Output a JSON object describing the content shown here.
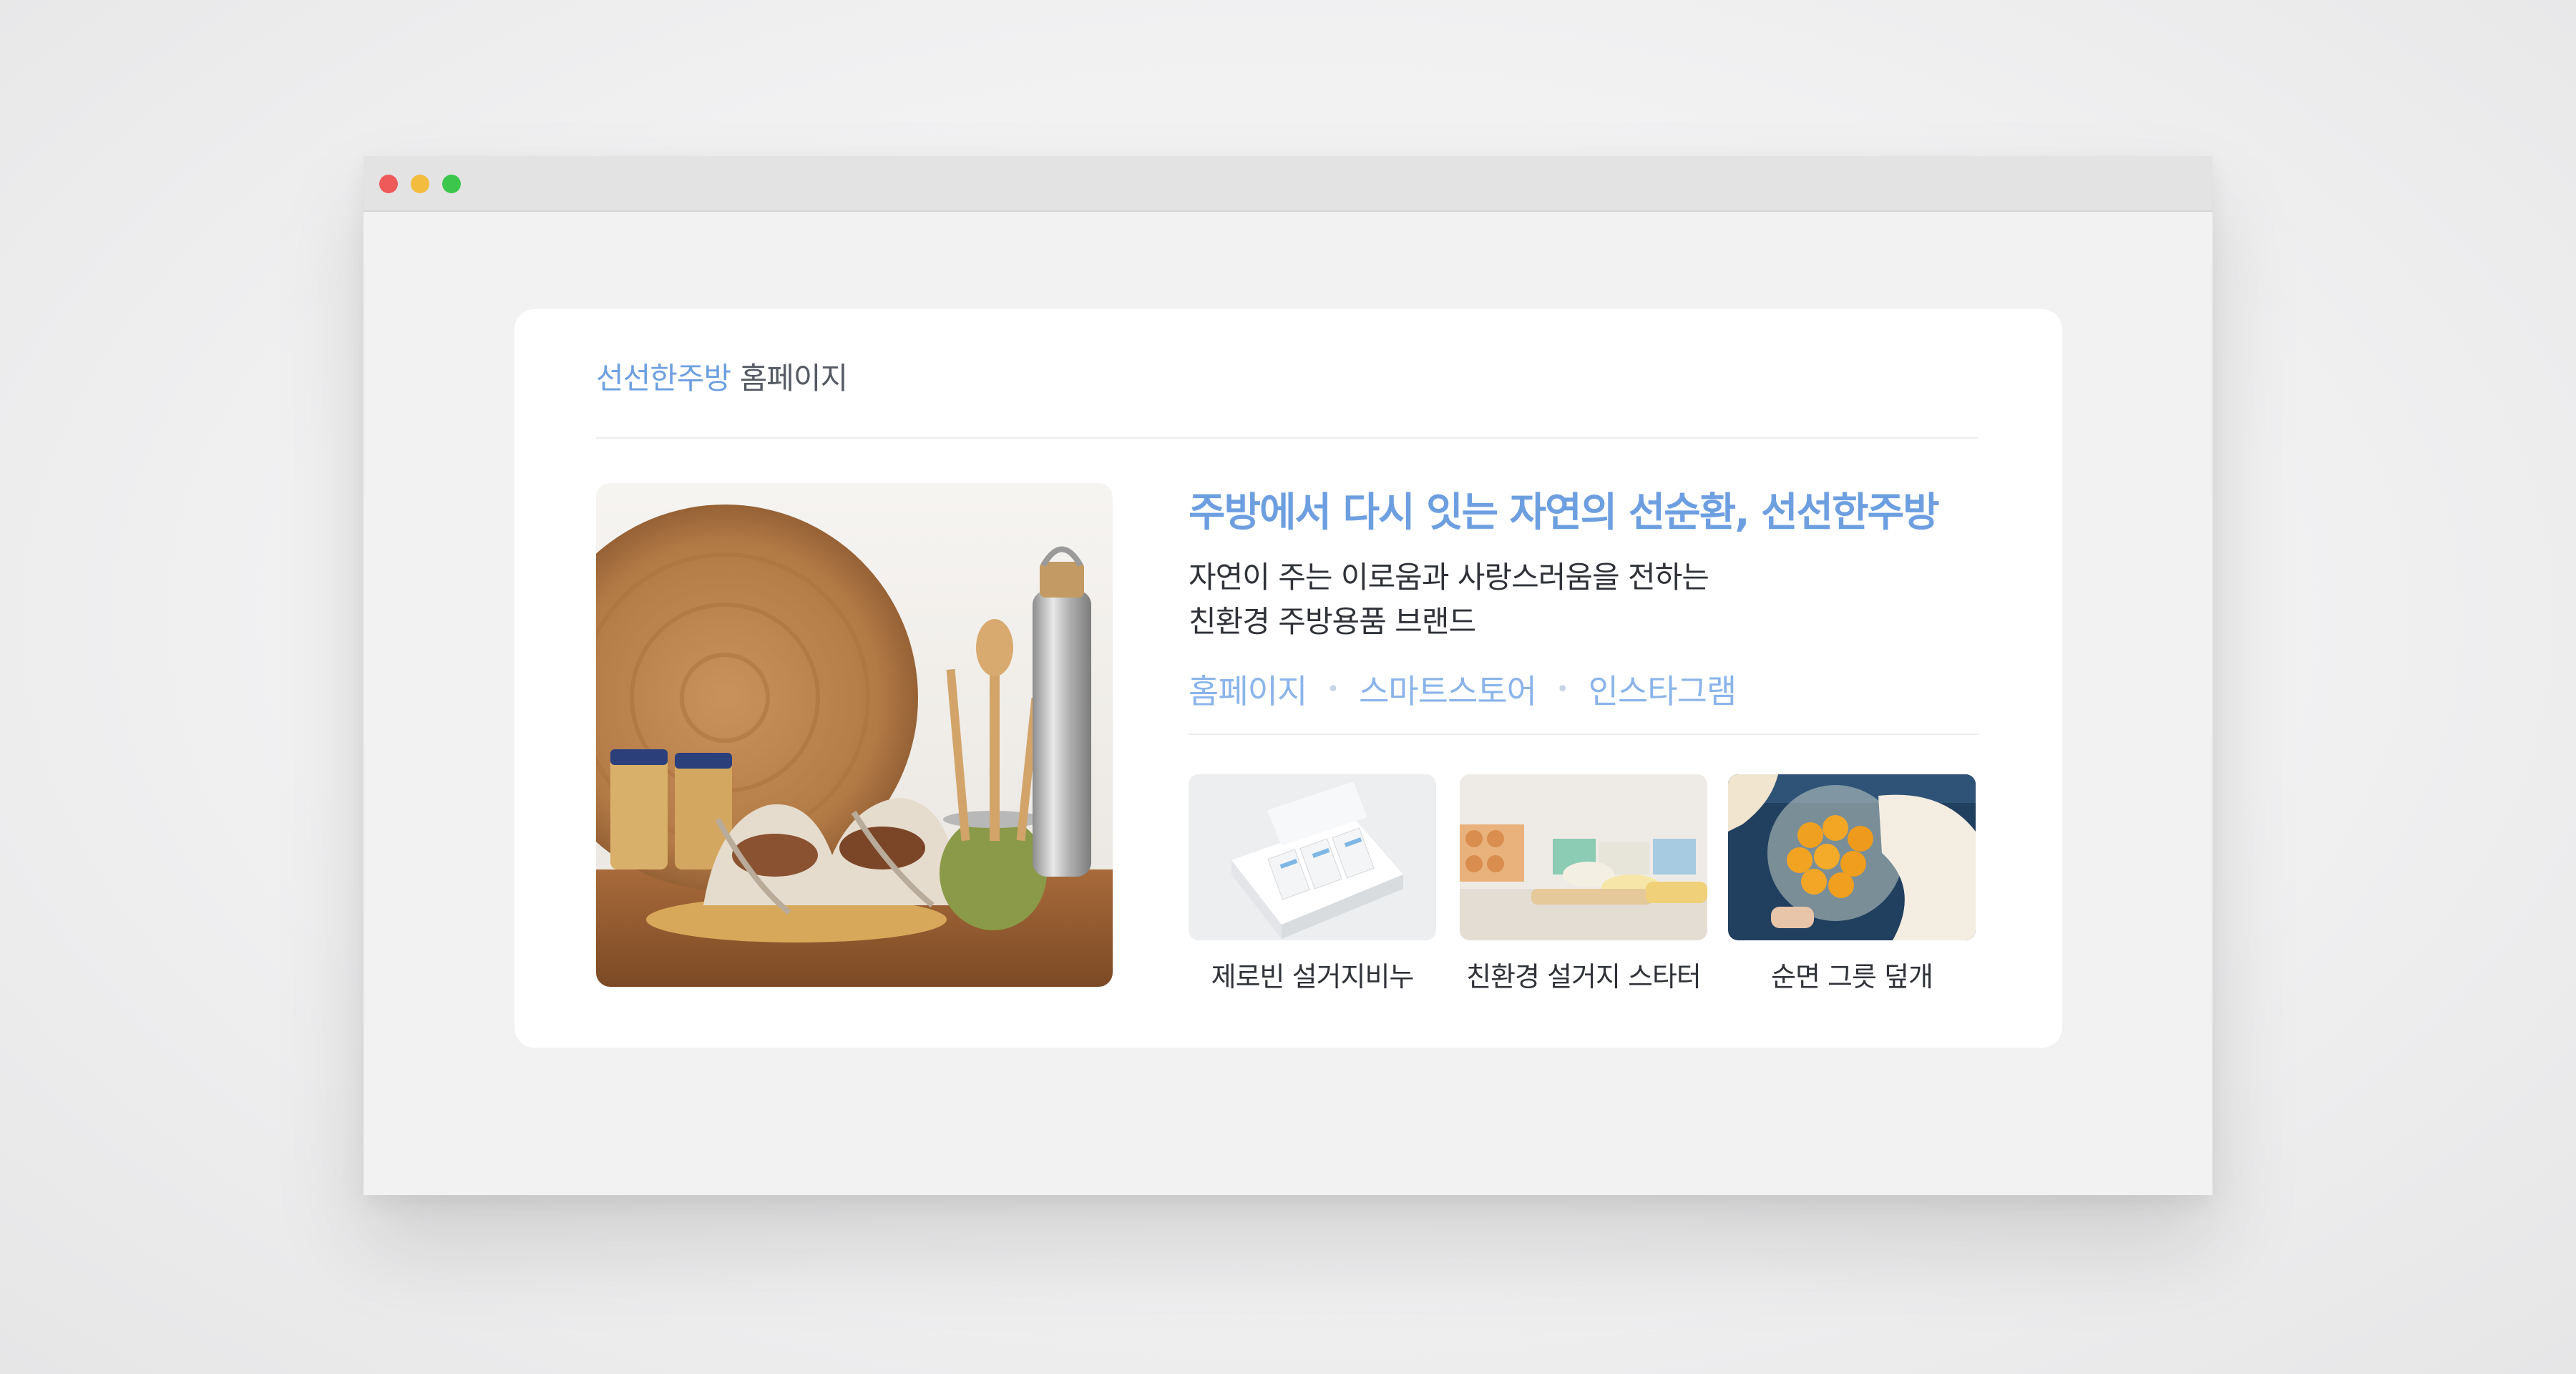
{
  "breadcrumb": {
    "brand": "선선한주방",
    "page": "홈페이지"
  },
  "headline": "주방에서 다시 잇는 자연의 선순환, 선선한주방",
  "description": {
    "line1": "자연이 주는 이로움과 사랑스러움을 전하는",
    "line2": "친환경 주방용품 브랜드"
  },
  "links": [
    {
      "label": "홈페이지"
    },
    {
      "label": "스마트스토어"
    },
    {
      "label": "인스타그램"
    }
  ],
  "products": [
    {
      "caption": "제로빈 설거지비누"
    },
    {
      "caption": "친환경 설거지 스타터"
    },
    {
      "caption": "순면 그릇 덮개"
    }
  ],
  "colors": {
    "accent": "#6d9fe0",
    "link": "#8ab4ea",
    "text": "#2f3238",
    "card": "#ffffff"
  },
  "icons": {
    "window_controls": [
      "close-dot",
      "minimize-dot",
      "maximize-dot"
    ]
  }
}
